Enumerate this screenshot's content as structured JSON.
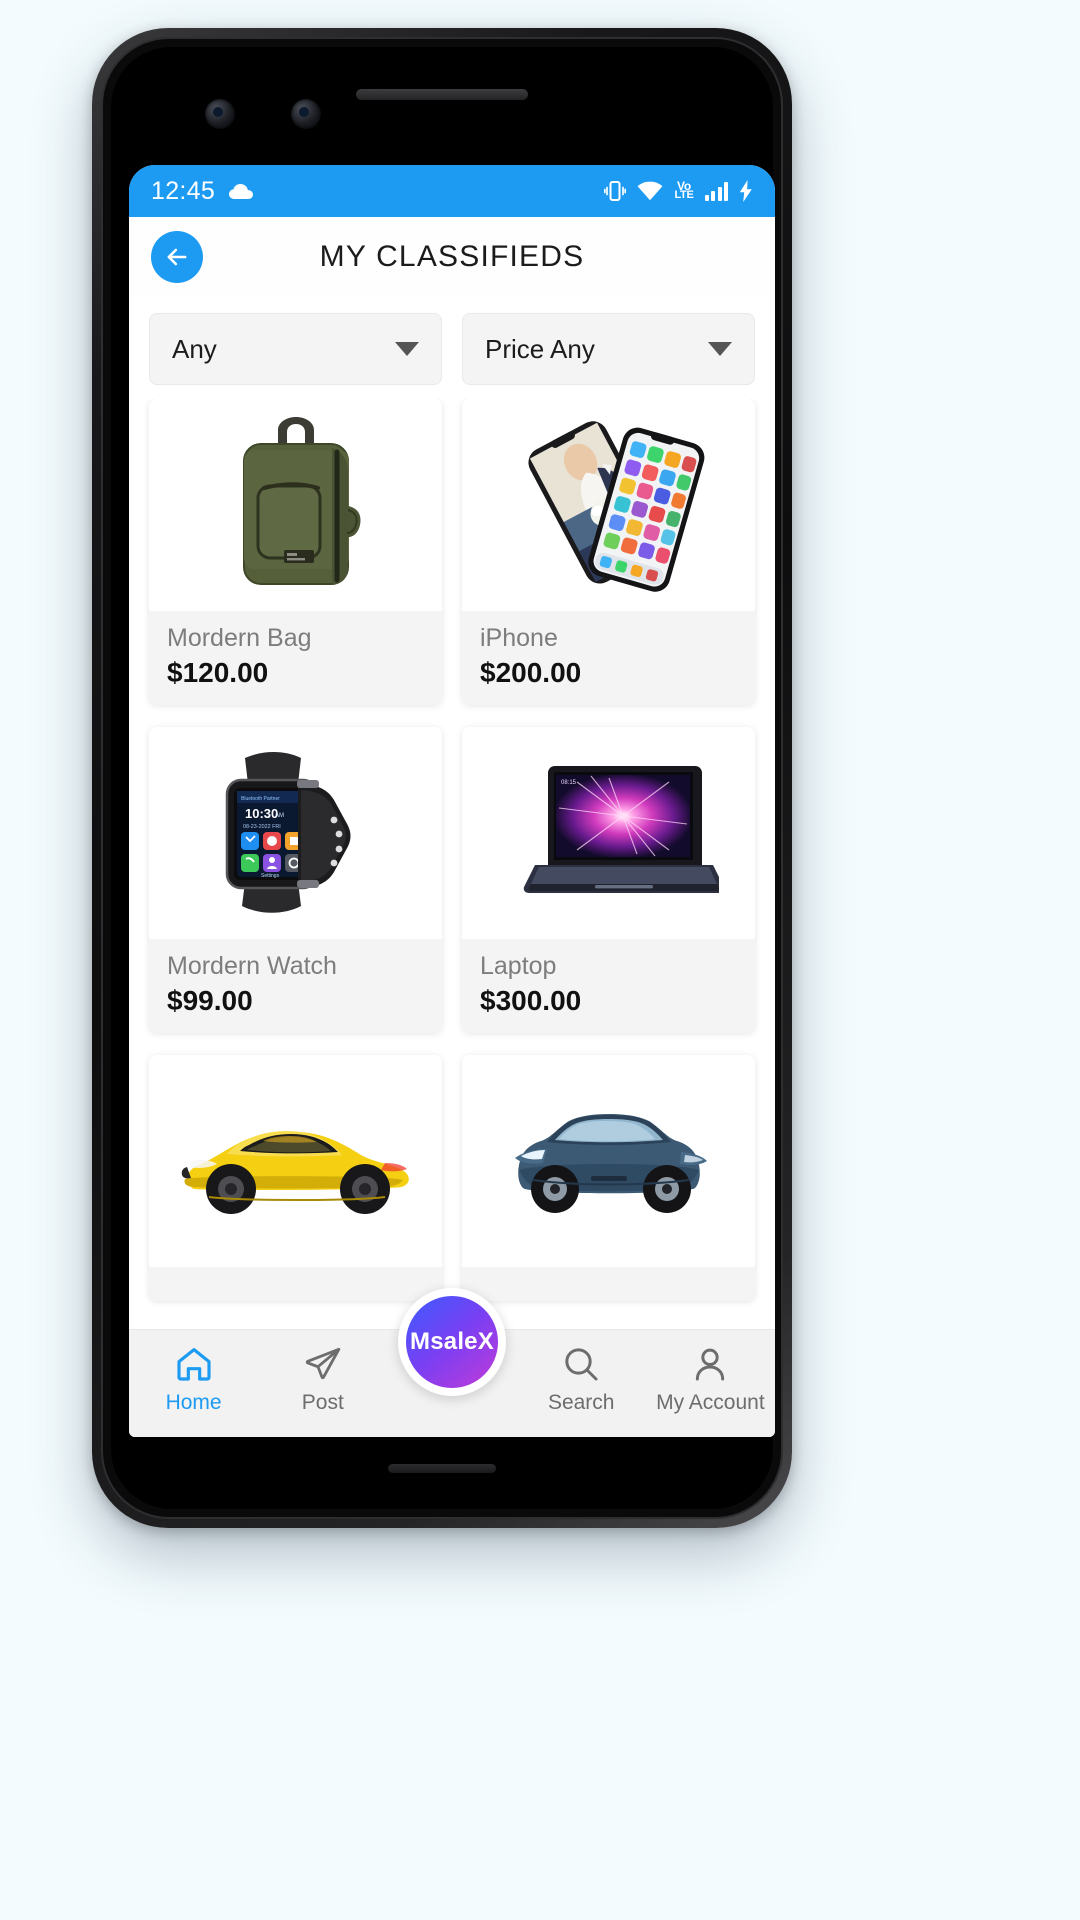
{
  "statusbar": {
    "time": "12:45",
    "icons": [
      "cloud-icon",
      "vibrate-icon",
      "wifi-icon",
      "volte-icon",
      "signal-bars-icon",
      "charging-bolt-icon"
    ],
    "volte_top": "Vo",
    "volte_bottom": "LTE",
    "bg_color": "#1d9bf3"
  },
  "appbar": {
    "back_icon": "arrow-left-icon",
    "title": "MY CLASSIFIEDS",
    "accent_color": "#1d9bf3"
  },
  "filters": [
    {
      "name": "category-filter",
      "label": "Any",
      "caret": "chevron-down-icon"
    },
    {
      "name": "price-filter",
      "label": "Price Any",
      "caret": "chevron-down-icon"
    }
  ],
  "products": [
    {
      "name": "Mordern Bag",
      "price": "$120.00",
      "image": "backpack-image"
    },
    {
      "name": "iPhone",
      "price": "$200.00",
      "image": "iphone-image"
    },
    {
      "name": "Mordern Watch",
      "price": "$99.00",
      "image": "smartwatch-image"
    },
    {
      "name": "Laptop",
      "price": "$300.00",
      "image": "laptop-image"
    },
    {
      "name": "",
      "price": "",
      "image": "yellow-sportscar-image"
    },
    {
      "name": "",
      "price": "",
      "image": "blue-suv-image"
    }
  ],
  "bottomnav": {
    "items": [
      {
        "label": "Home",
        "icon": "home-icon",
        "active": true
      },
      {
        "label": "Post",
        "icon": "send-icon",
        "active": false
      },
      {
        "label": "Search",
        "icon": "search-icon",
        "active": false
      },
      {
        "label": "My Account",
        "icon": "person-icon",
        "active": false
      }
    ],
    "fab_label": "MsaleX",
    "active_color": "#1d9bf3",
    "inactive_color": "#6d6d6d"
  }
}
